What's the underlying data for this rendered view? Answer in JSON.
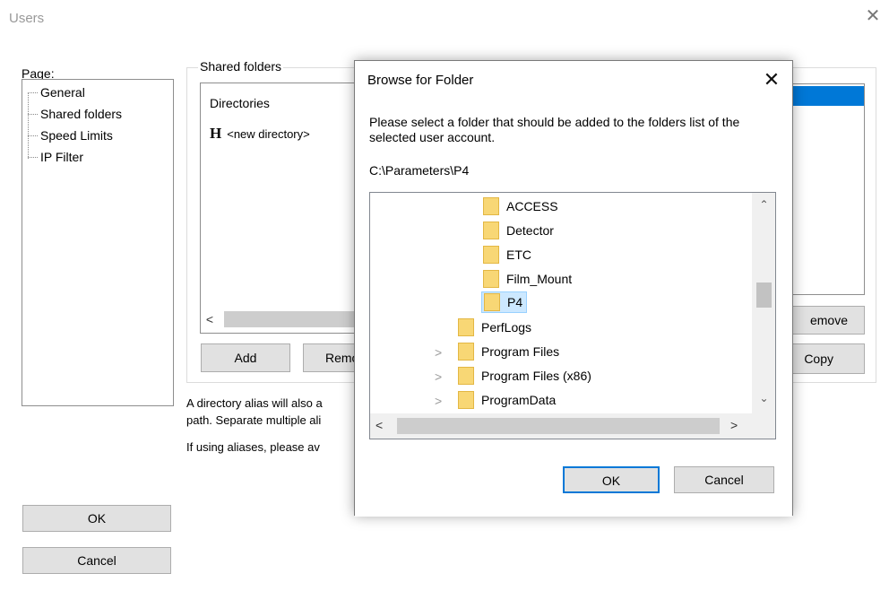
{
  "window": {
    "title": "Users",
    "close_glyph": "✕"
  },
  "page": {
    "label": "Page:",
    "items": [
      {
        "label": "General"
      },
      {
        "label": "Shared folders"
      },
      {
        "label": "Speed Limits"
      },
      {
        "label": "IP Filter"
      }
    ]
  },
  "shared": {
    "group_label": "Shared folders",
    "list_header": "Directories",
    "row_marker": "H",
    "row_text": "<new directory>",
    "add_label": "Add",
    "remove_partial_label": "Remo",
    "right_remove_label": "emove",
    "right_copy_label": "Copy",
    "desc_line1": "A directory alias will also a",
    "desc_line2": "path. Separate multiple ali",
    "desc_line3": "If using aliases, please av"
  },
  "footer": {
    "ok_label": "OK",
    "cancel_label": "Cancel"
  },
  "browse": {
    "title": "Browse for Folder",
    "instruction": "Please select a folder that should be added to the folders list of the selected user account.",
    "path": "C:\\Parameters\\P4",
    "tree": [
      {
        "label": "ACCESS",
        "level": 2,
        "expander": ""
      },
      {
        "label": "Detector",
        "level": 2,
        "expander": ""
      },
      {
        "label": "ETC",
        "level": 2,
        "expander": ""
      },
      {
        "label": "Film_Mount",
        "level": 2,
        "expander": ""
      },
      {
        "label": "P4",
        "level": 2,
        "expander": "",
        "selected": true
      },
      {
        "label": "PerfLogs",
        "level": 1,
        "expander": ""
      },
      {
        "label": "Program Files",
        "level": 1,
        "expander": ">"
      },
      {
        "label": "Program Files (x86)",
        "level": 1,
        "expander": ">"
      },
      {
        "label": "ProgramData",
        "level": 1,
        "expander": ">"
      }
    ],
    "ok_label": "OK",
    "cancel_label": "Cancel"
  },
  "colors": {
    "accent": "#0078d7",
    "folder": "#f8d775",
    "selection": "#cce8ff"
  }
}
